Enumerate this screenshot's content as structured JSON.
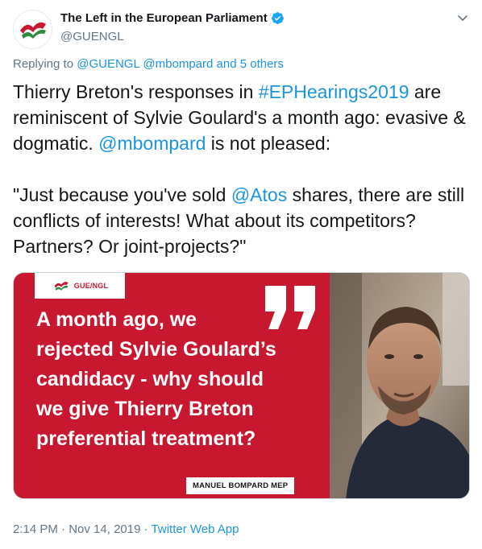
{
  "author": {
    "display_name": "The Left in the European Parliament",
    "handle": "@GUENGL",
    "verified": true
  },
  "menu": {
    "icon": "chevron-down-icon"
  },
  "reply_context": {
    "prefix": "Replying to",
    "mentions": [
      "@GUENGL",
      "@mbompard"
    ],
    "others": "and 5 others"
  },
  "tweet": {
    "p1_part1": "Thierry Breton's responses in ",
    "hashtag": "#EPHearings2019",
    "p1_part2": " are reminiscent of Sylvie Goulard's a month ago: evasive & dogmatic. ",
    "mention_mbompard": "@mbompard",
    "p1_part3": " is not pleased:",
    "p2_part1": "\"Just because you've sold ",
    "mention_atos": "@Atos",
    "p2_part2": " shares, there are still conflicts of interests! What about its competitors? Partners? Or joint-projects?\""
  },
  "media": {
    "logo_text": "GUE/NGL",
    "headline_lines": [
      "A month ago, we",
      "rejected Sylvie Goulard’s",
      "candidacy - why should",
      "we give Thierry Breton",
      "preferential treatment?"
    ],
    "credit": "MANUEL BOMPARD MEP",
    "brand_red": "#c8182f"
  },
  "footer": {
    "time": "2:14 PM",
    "separator": "·",
    "date": "Nov 14, 2019",
    "source": "Twitter Web App"
  }
}
